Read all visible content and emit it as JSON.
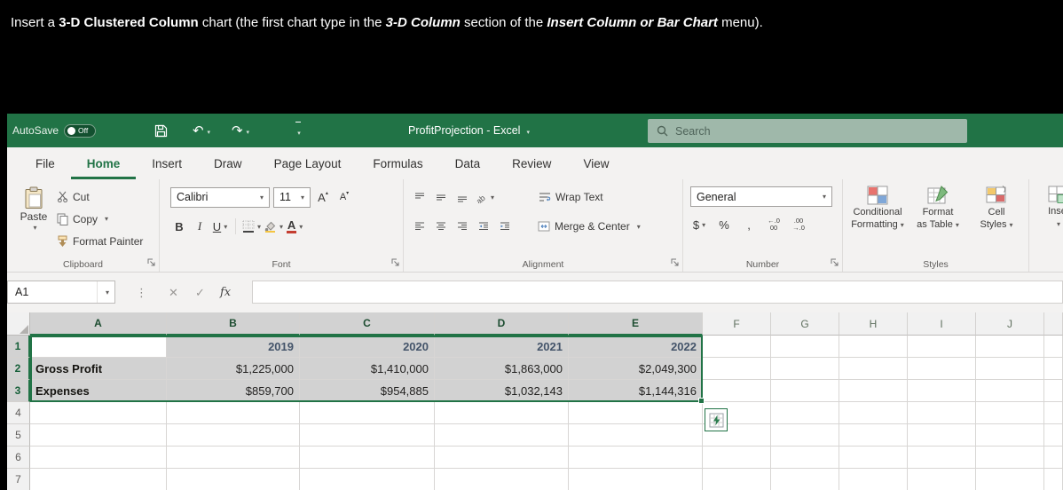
{
  "instruction": {
    "segments": [
      "Insert a ",
      "3-D Clustered Column",
      " chart (the first chart type in the ",
      "3-D Column",
      " section of the ",
      "Insert Column or Bar Chart",
      " menu)."
    ]
  },
  "titlebar": {
    "autosave_label": "AutoSave",
    "autosave_state": "Off",
    "document_title": "ProfitProjection - Excel",
    "search_placeholder": "Search"
  },
  "ribbon_tabs": [
    "File",
    "Home",
    "Insert",
    "Draw",
    "Page Layout",
    "Formulas",
    "Data",
    "Review",
    "View"
  ],
  "active_tab": "Home",
  "ribbon": {
    "clipboard": {
      "group_label": "Clipboard",
      "paste_label": "Paste",
      "cut_label": "Cut",
      "copy_label": "Copy",
      "format_painter_label": "Format Painter"
    },
    "font": {
      "group_label": "Font",
      "font_name": "Calibri",
      "font_size": "11",
      "bold_label": "B",
      "italic_label": "I",
      "underline_label": "U"
    },
    "alignment": {
      "group_label": "Alignment",
      "wrap_text_label": "Wrap Text",
      "merge_center_label": "Merge & Center"
    },
    "number": {
      "group_label": "Number",
      "format_value": "General",
      "currency_label": "$",
      "percent_label": "%",
      "comma_label": ","
    },
    "styles": {
      "group_label": "Styles",
      "conditional_line1": "Conditional",
      "conditional_line2": "Formatting",
      "table_line1": "Format",
      "table_line2": "as Table",
      "cellstyles_line1": "Cell",
      "cellstyles_line2": "Styles"
    },
    "insert_partial_label": "Inse"
  },
  "formula_bar": {
    "name_box_value": "A1",
    "cancel_glyph": "✕",
    "enter_glyph": "✓",
    "fx_glyph": "fx",
    "formula_value": ""
  },
  "icons": {
    "undo": "↶",
    "redo": "↷",
    "grip": "⋮"
  },
  "sheet": {
    "column_letters": [
      "A",
      "B",
      "C",
      "D",
      "E",
      "F",
      "G",
      "H",
      "I",
      "J"
    ],
    "row_numbers": [
      "1",
      "2",
      "3",
      "4",
      "5",
      "6",
      "7"
    ],
    "selection": "A1:E3",
    "active_cell": "A1",
    "rows": [
      {
        "cells": [
          "",
          "2019",
          "2020",
          "2021",
          "2022"
        ]
      },
      {
        "cells": [
          "Gross Profit",
          "$1,225,000",
          "$1,410,000",
          "$1,863,000",
          "$2,049,300"
        ]
      },
      {
        "cells": [
          "Expenses",
          "$859,700",
          "$954,885",
          "$1,032,143",
          "$1,144,316"
        ]
      }
    ]
  },
  "colors": {
    "excel_green": "#217346",
    "selection_fill": "#d2d2d2",
    "heading_text": "#44546a"
  }
}
